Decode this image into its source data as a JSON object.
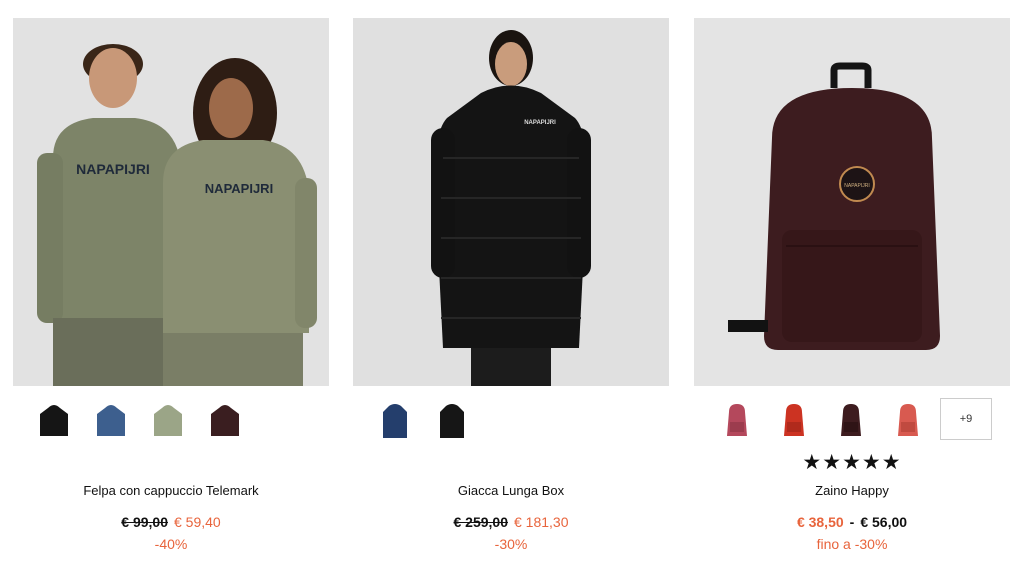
{
  "products": [
    {
      "name": "Felpa con cappuccio Telemark",
      "old_price": "€ 99,00",
      "new_price": "€ 59,40",
      "discount": "-40%",
      "image_alt": "Two models wearing olive hoodies with NAPAPIJRI logo",
      "swatches": [
        {
          "name": "black",
          "color": "#151515"
        },
        {
          "name": "blue",
          "color": "#3d5f8e"
        },
        {
          "name": "olive",
          "color": "#9ba587"
        },
        {
          "name": "burgundy",
          "color": "#3a1e20"
        }
      ]
    },
    {
      "name": "Giacca Lunga Box",
      "old_price": "€ 259,00",
      "new_price": "€ 181,30",
      "discount": "-30%",
      "image_alt": "Model wearing long black puffer jacket",
      "swatches": [
        {
          "name": "navy",
          "color": "#243e6c"
        },
        {
          "name": "black",
          "color": "#161616"
        }
      ]
    },
    {
      "name": "Zaino Happy",
      "price_from": "€ 38,50",
      "price_sep": "-",
      "price_to": "€ 56,00",
      "discount": "fino a -30%",
      "rating": "★★★★★",
      "more_colors": "+9",
      "image_alt": "Burgundy backpack with round patch logo",
      "swatches": [
        {
          "name": "rose",
          "color": "#b4485c"
        },
        {
          "name": "red",
          "color": "#cc3322"
        },
        {
          "name": "burgundy",
          "color": "#3d1c1f"
        },
        {
          "name": "coral",
          "color": "#d85a50"
        }
      ]
    }
  ]
}
